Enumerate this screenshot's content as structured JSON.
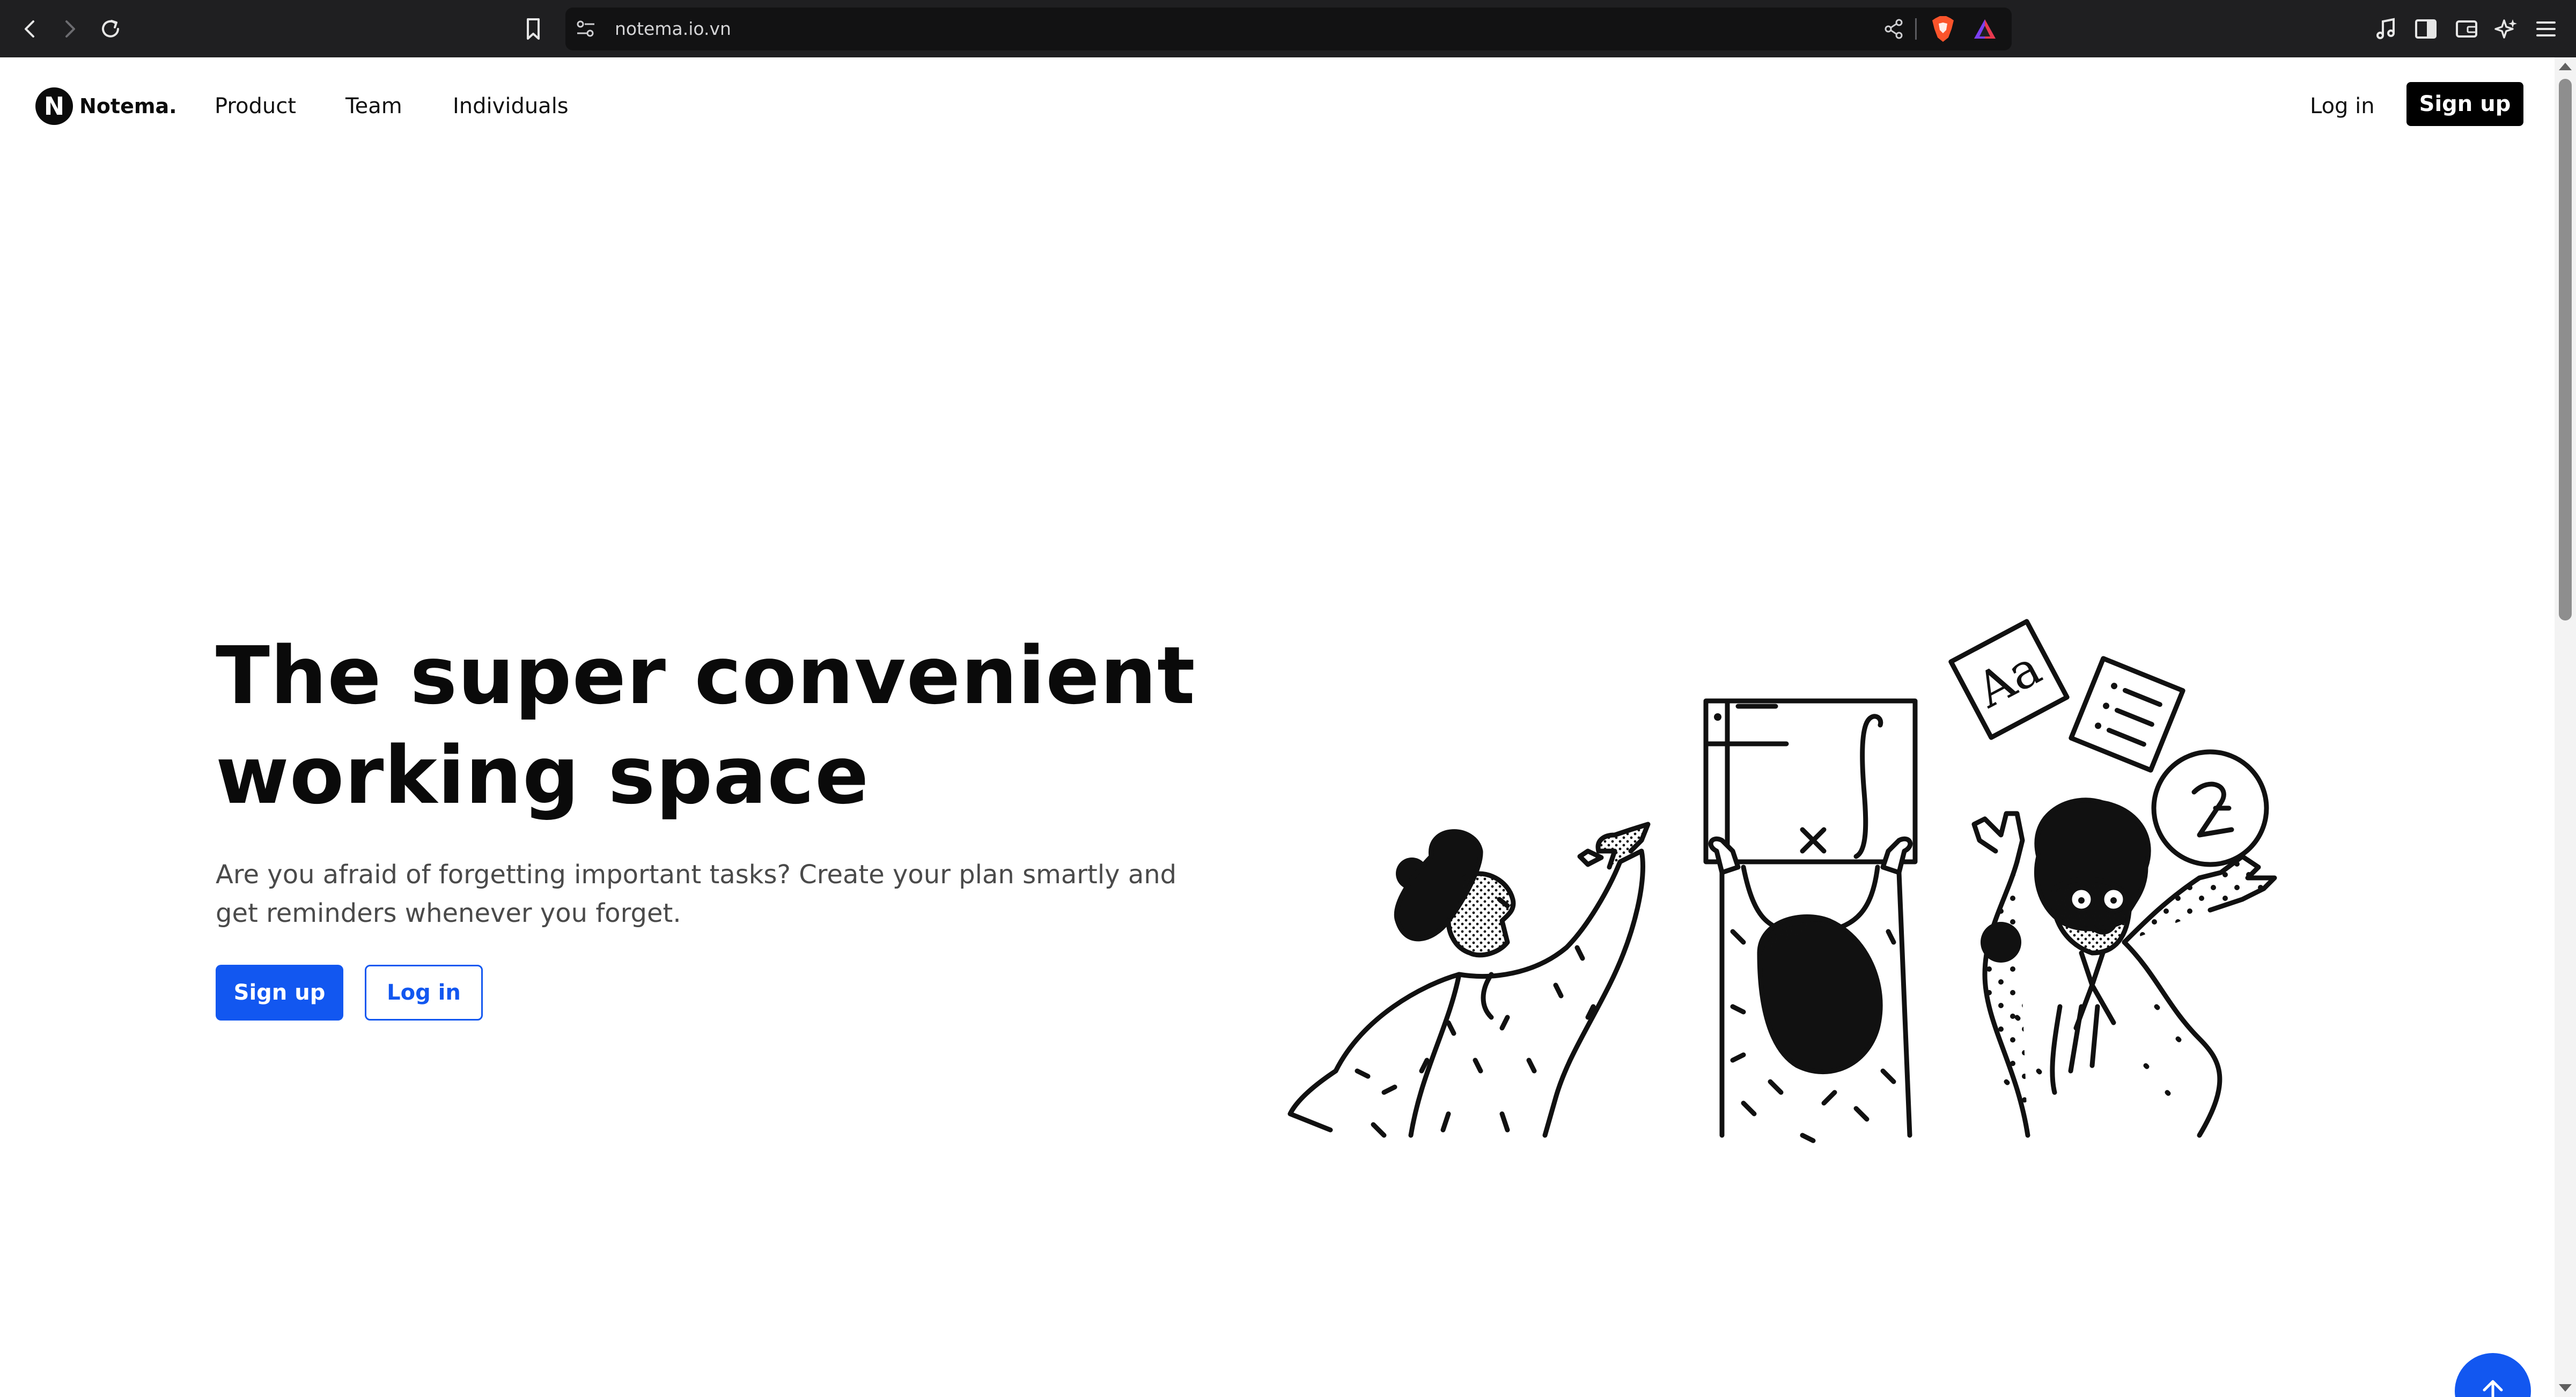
{
  "browser": {
    "url": "notema.io.vn",
    "icons": {
      "back": "back-arrow-icon",
      "forward": "forward-arrow-icon",
      "reload": "reload-icon",
      "bookmark": "bookmark-icon",
      "site_settings": "site-settings-icon",
      "share": "share-icon",
      "brave_shields": "brave-shields-icon",
      "brave_rewards": "brave-rewards-icon",
      "media": "media-icon",
      "sidebar": "sidebar-icon",
      "wallet": "wallet-icon",
      "leo": "leo-ai-icon",
      "menu": "menu-icon"
    }
  },
  "nav": {
    "brand": "Notema.",
    "logo_letter": "N",
    "links": [
      "Product",
      "Team",
      "Individuals"
    ],
    "login_label": "Log in",
    "signup_label": "Sign up"
  },
  "hero": {
    "title": "The super convenient working space",
    "subtitle": "Are you afraid of forgetting important tasks? Create your plan smartly and get reminders whenever you forget.",
    "signup_label": "Sign up",
    "login_label": "Log in"
  },
  "illustration": {
    "card_text": "Aa"
  },
  "colors": {
    "primary": "#1257f0",
    "nav_button": "#000000",
    "chrome": "#1f1f21",
    "text": "#0a0a0a",
    "subtitle": "#4a4a4a"
  },
  "floating": {
    "scroll_top_icon": "arrow-up-icon"
  }
}
